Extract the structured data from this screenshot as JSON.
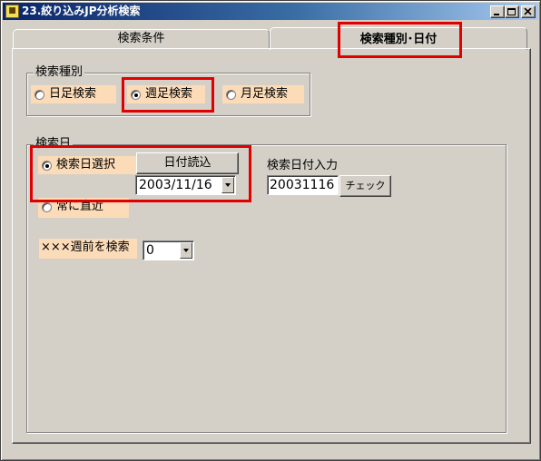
{
  "window": {
    "title": "23.絞り込みJP分析検索",
    "icon": "app-icon",
    "minimize_icon": "minimize-icon",
    "maximize_icon": "maximize-icon",
    "close_icon": "close-icon"
  },
  "tabs": [
    {
      "label": "検索条件",
      "active": false
    },
    {
      "label": "検索種別･日付",
      "active": true
    }
  ],
  "search_type_group": {
    "title": "検索種別",
    "options": [
      {
        "label": "日足検索",
        "checked": false
      },
      {
        "label": "週足検索",
        "checked": true
      },
      {
        "label": "月足検索",
        "checked": false
      }
    ]
  },
  "search_date_group": {
    "title": "検索日",
    "select_date_option": {
      "label": "検索日選択",
      "checked": true
    },
    "read_date_button": "日付読込",
    "date_combo_value": "2003/11/16",
    "date_input_label": "検索日付入力",
    "date_input_value": "20031116",
    "check_button": "チェック",
    "always_latest_option": {
      "label": "常に直近",
      "checked": false
    },
    "weeks_before_label": "×××週前を検索",
    "weeks_before_value": "0"
  },
  "colors": {
    "highlight": "#e00000",
    "option_bg": "#fcdcb8",
    "face": "#d4d0c8"
  }
}
